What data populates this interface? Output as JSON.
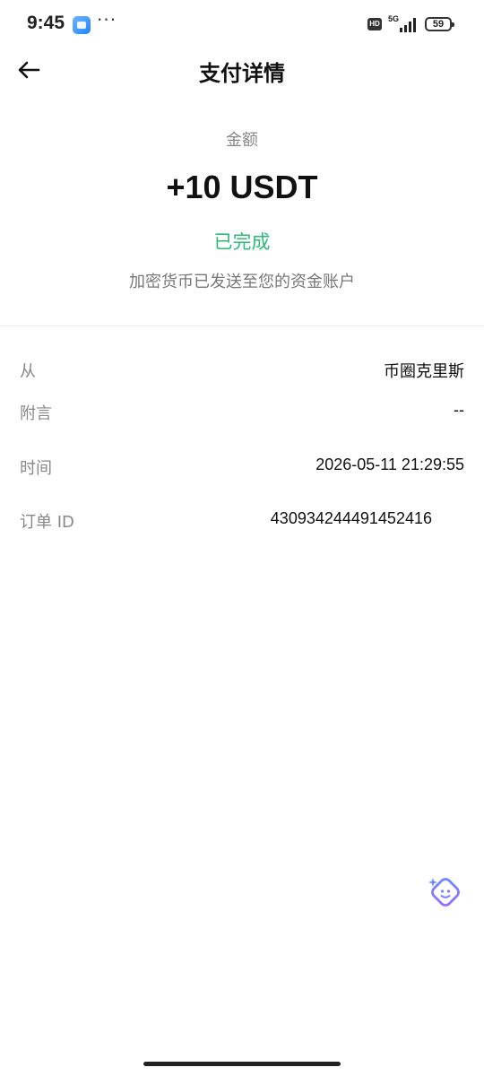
{
  "status_bar": {
    "time": "9:45",
    "more": "···",
    "hd": "HD",
    "network": "5G",
    "battery": "59"
  },
  "header": {
    "back_icon": "arrow-left-icon",
    "title": "支付详情"
  },
  "summary": {
    "amount_label": "金额",
    "amount": "+10 USDT",
    "status": "已完成",
    "status_color": "#2dbb77",
    "description": "加密货币已发送至您的资金账户"
  },
  "details": [
    {
      "label": "从",
      "value": "币圈克里斯"
    },
    {
      "label": "附言",
      "value": "--"
    },
    {
      "label": "时间",
      "value": "2026-05-11 21:29:55"
    },
    {
      "label": "订单 ID",
      "value": "430934244491452416"
    }
  ],
  "floating": {
    "assistant_icon": "smart-assistant-icon"
  }
}
